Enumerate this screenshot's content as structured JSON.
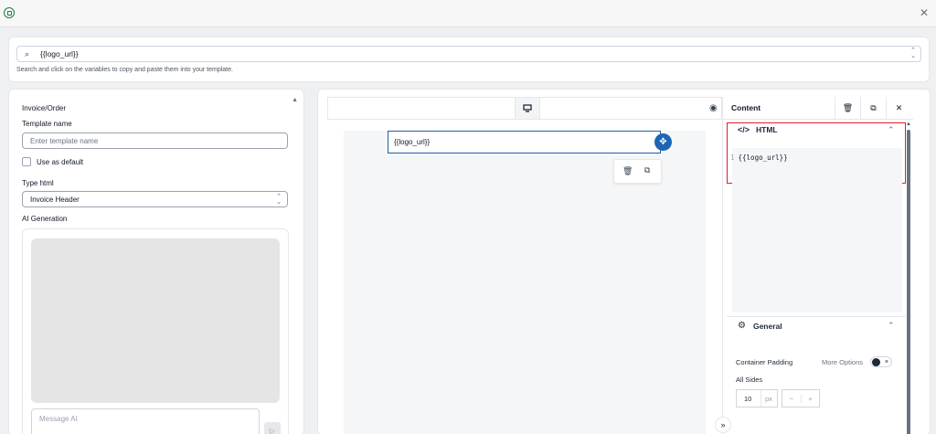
{
  "variables": {
    "selected": "{{logo_url}}",
    "hint": "Search and click on the variables to copy and paste them into your template."
  },
  "form": {
    "section_title": "Invoice/Order",
    "template_name_label": "Template name",
    "template_name_placeholder": "Enter template name",
    "use_default_label": "Use as default",
    "type_label": "Type html",
    "type_value": "Invoice Header",
    "ai_label": "AI Generation",
    "message_placeholder": "Message AI"
  },
  "canvas": {
    "block_text": "{{logo_url}}"
  },
  "panel": {
    "title": "Content",
    "html_label": "HTML",
    "code_line_number": "1",
    "code_text": "{{logo_url}}",
    "general_label": "General",
    "container_padding_label": "Container Padding",
    "more_options_label": "More Options",
    "all_sides_label": "All Sides",
    "padding_value": "10",
    "padding_unit": "px",
    "minus": "−",
    "plus": "+"
  },
  "icons": {
    "app": "app-logo-icon",
    "close": "close-icon",
    "search": "search-icon",
    "chevron": "chevron-updown-icon",
    "monitor": "monitor-icon",
    "eye": "eye-icon",
    "trash": "trash-icon",
    "duplicate": "duplicate-icon",
    "move": "move-icon",
    "code": "code-icon",
    "gear": "gear-icon",
    "collapse": "double-chevron-icon"
  },
  "colors": {
    "accent": "#1e66b5",
    "highlight": "#e11d2a",
    "brand": "#15803d"
  }
}
